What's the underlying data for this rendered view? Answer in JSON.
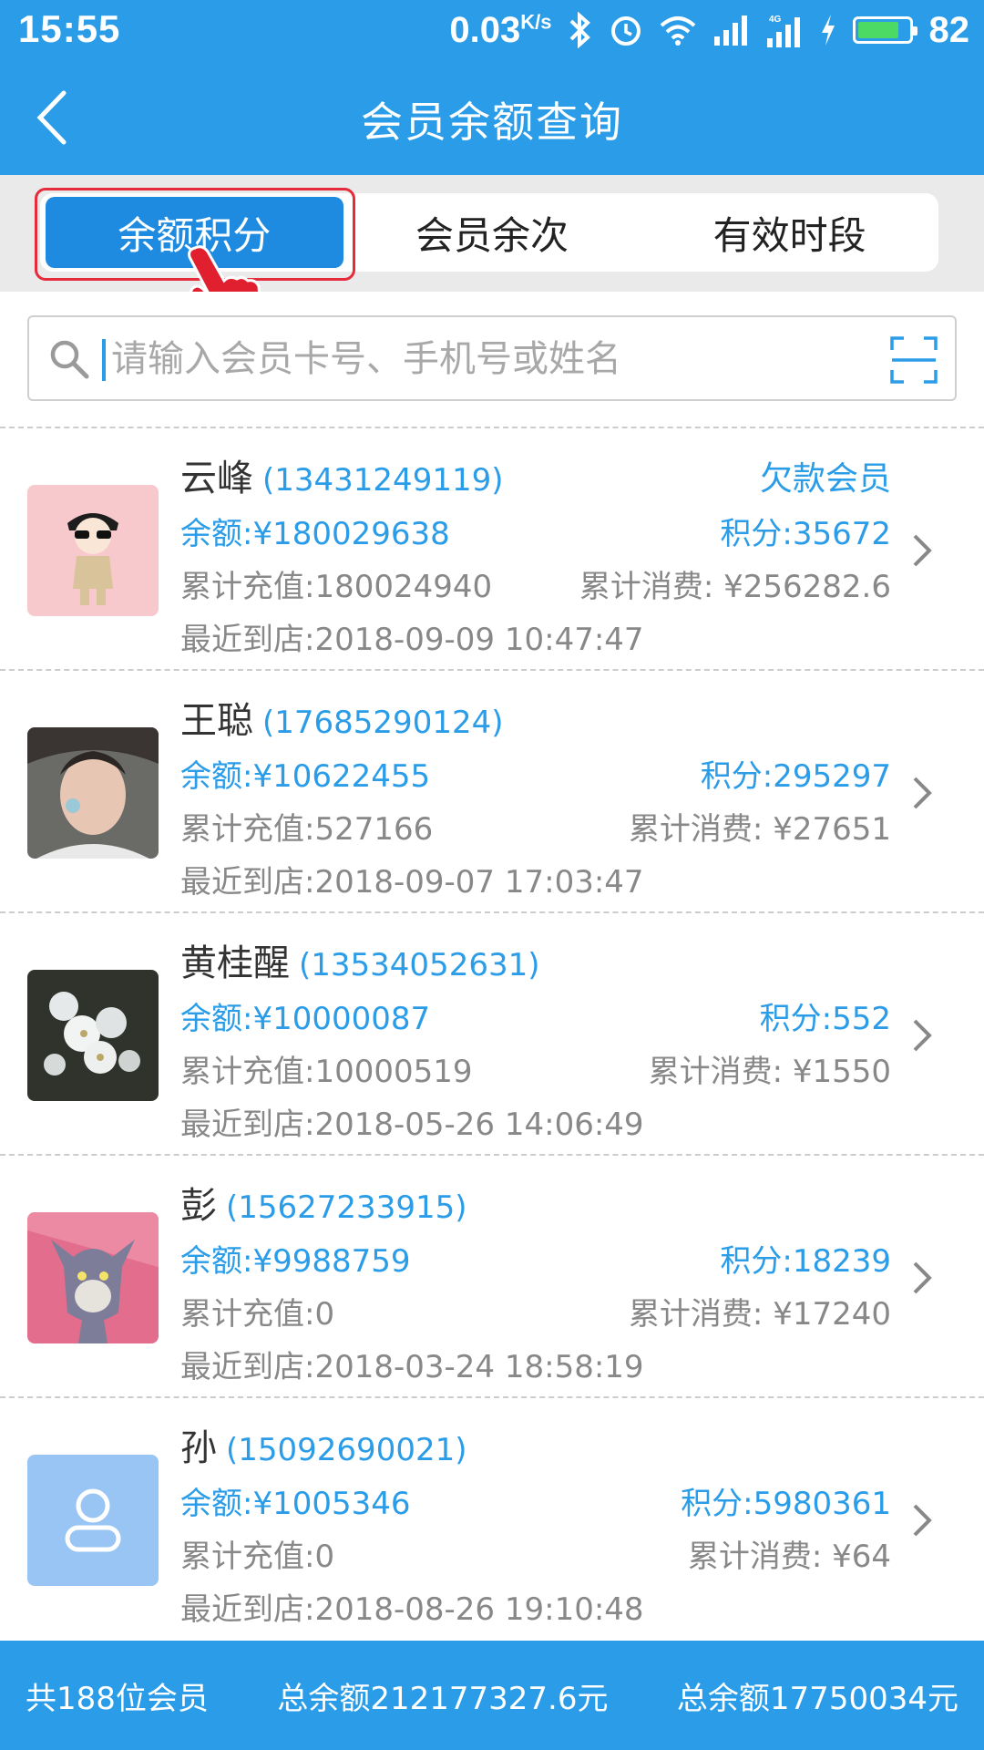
{
  "status_bar": {
    "time": "15:55",
    "speed": "0.03",
    "speed_unit": "K/s",
    "battery": "82"
  },
  "header": {
    "title": "会员余额查询"
  },
  "tabs": [
    {
      "label": "余额积分",
      "active": true
    },
    {
      "label": "会员余次",
      "active": false
    },
    {
      "label": "有效时段",
      "active": false
    }
  ],
  "search": {
    "placeholder": "请输入会员卡号、手机号或姓名"
  },
  "members": [
    {
      "name": "云峰",
      "phone": "(13431249119)",
      "tag": "欠款会员",
      "balance": "余额:¥180029638",
      "points": "积分:35672",
      "recharge": "累计充值:180024940",
      "consume": "累计消费: ¥256282.6",
      "last_visit": "最近到店:2018-09-09 10:47:47"
    },
    {
      "name": "王聪",
      "phone": "(17685290124)",
      "tag": "",
      "balance": "余额:¥10622455",
      "points": "积分:295297",
      "recharge": "累计充值:527166",
      "consume": "累计消费: ¥27651",
      "last_visit": "最近到店:2018-09-07 17:03:47"
    },
    {
      "name": "黄桂醒",
      "phone": "(13534052631)",
      "tag": "",
      "balance": "余额:¥10000087",
      "points": "积分:552",
      "recharge": "累计充值:10000519",
      "consume": "累计消费: ¥1550",
      "last_visit": "最近到店:2018-05-26 14:06:49"
    },
    {
      "name": "彭",
      "phone": "(15627233915)",
      "tag": "",
      "balance": "余额:¥9988759",
      "points": "积分:18239",
      "recharge": "累计充值:0",
      "consume": "累计消费: ¥17240",
      "last_visit": "最近到店:2018-03-24 18:58:19"
    },
    {
      "name": "孙",
      "phone": "(15092690021)",
      "tag": "",
      "balance": "余额:¥1005346",
      "points": "积分:5980361",
      "recharge": "累计充值:0",
      "consume": "累计消费: ¥64",
      "last_visit": "最近到店:2018-08-26 19:10:48"
    }
  ],
  "footer": {
    "member_count": "共188位会员",
    "total_balance_1": "总余额212177327.6元",
    "total_balance_2": "总余额17750034元"
  },
  "colors": {
    "primary": "#2a9ce8",
    "tab_active": "#1e8be0",
    "highlight": "#e62b3a"
  }
}
